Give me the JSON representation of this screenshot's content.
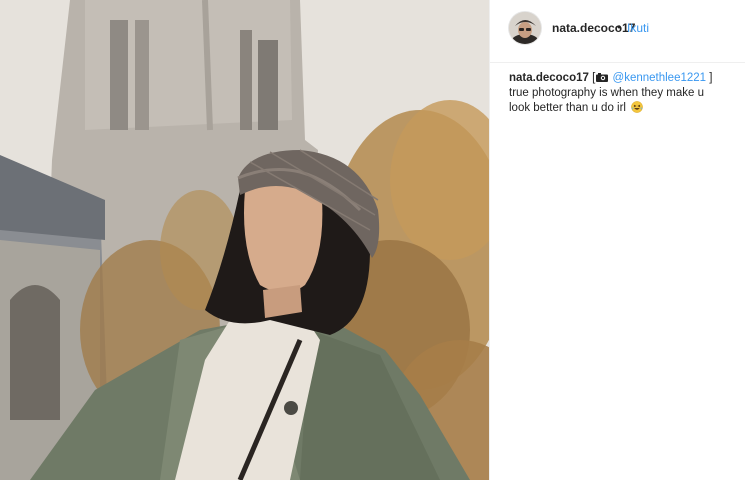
{
  "post": {
    "author": {
      "username": "nata.decoco17",
      "separator": "•",
      "follow_label": "Ikuti"
    },
    "caption": {
      "username": "nata.decoco17",
      "bracket_open": "[",
      "camera_icon": "camera-icon",
      "mention": "@kennethlee1221",
      "bracket_close": "]",
      "line1": "true photography is when they make u",
      "line2": "look better than u do irl",
      "emoji_icon": "crying-laughing-emoji-icon"
    }
  },
  "colors": {
    "link": "#3897f0",
    "text": "#262626",
    "border": "#efefef"
  }
}
